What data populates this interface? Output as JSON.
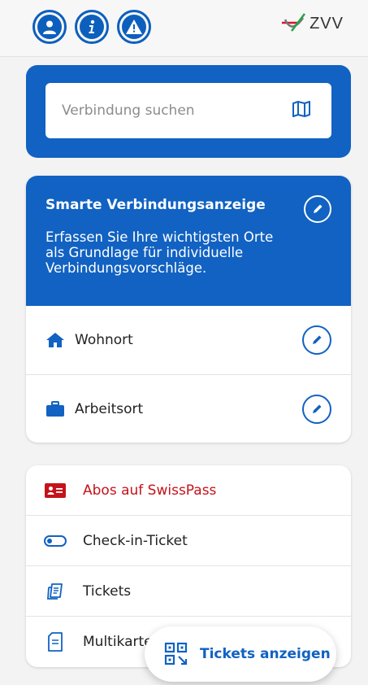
{
  "header": {
    "icons": [
      "user-icon",
      "info-icon",
      "warning-icon"
    ],
    "logo_text": "ZVV"
  },
  "search": {
    "placeholder": "Verbindung suchen",
    "map_icon": "map-icon"
  },
  "smart": {
    "title": "Smarte Verbindungsanzeige",
    "description": "Erfassen Sie Ihre wichtigsten Orte als Grundlage für individuelle Verbindungsvorschläge.",
    "places": [
      {
        "label": "Wohnort",
        "icon": "home-icon"
      },
      {
        "label": "Arbeitsort",
        "icon": "briefcase-icon"
      }
    ]
  },
  "menu": {
    "items": [
      {
        "label": "Abos auf SwissPass",
        "icon": "swisspass-card-icon"
      },
      {
        "label": "Check-in-Ticket",
        "icon": "toggle-icon"
      },
      {
        "label": "Tickets",
        "icon": "tickets-icon"
      },
      {
        "label": "Multikarte",
        "icon": "multicard-icon"
      }
    ]
  },
  "fab": {
    "label": "Tickets anzeigen",
    "icon": "qr-code-icon"
  },
  "colors": {
    "primary": "#1162c2",
    "swisspass_red": "#c4121a"
  }
}
